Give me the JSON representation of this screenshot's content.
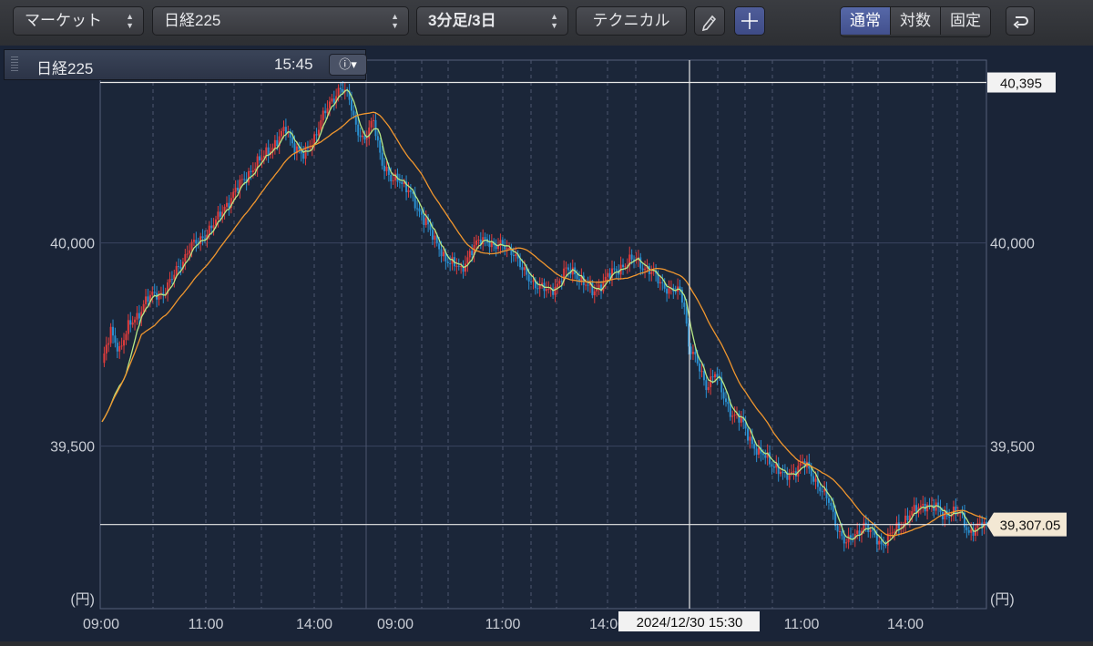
{
  "toolbar": {
    "market": "マーケット",
    "symbol": "日経225",
    "period": "3分足/3日",
    "technical": "テクニカル",
    "modes": [
      "通常",
      "対数",
      "固定"
    ]
  },
  "infobar": {
    "symbol": "日経225",
    "time": "15:45"
  },
  "icons": {
    "select_arrows": "up-down-chevron-icon",
    "pencil": "pencil-icon",
    "crosshair": "crosshair-icon",
    "undo": "undo-icon",
    "info": "info-icon"
  },
  "colors": {
    "background": "#1a2437",
    "up_candle": "#e03c3c",
    "down_candle": "#2a8fd0",
    "ma_short": "#b8e986",
    "ma_long": "#f0962e"
  },
  "chart_data": {
    "type": "line",
    "x_tick_labels": [
      "09:00",
      "11:00",
      "14:00",
      "09:00",
      "11:00",
      "14:00",
      "11:00",
      "14:00"
    ],
    "y_ticks": [
      40000,
      39500
    ],
    "y_tick_labels": [
      "40,000",
      "39,500"
    ],
    "y_unit": "(円)",
    "ylim": [
      39100,
      40450
    ],
    "high_label": "40,395",
    "high_value": 40395,
    "last_label": "39,307.05",
    "last_value": 39307.05,
    "cursor_label": "2024/12/30 15:30",
    "price_path": [
      [
        0,
        39700
      ],
      [
        4,
        39780
      ],
      [
        8,
        39740
      ],
      [
        12,
        39790
      ],
      [
        16,
        39820
      ],
      [
        20,
        39860
      ],
      [
        24,
        39870
      ],
      [
        28,
        39880
      ],
      [
        32,
        39910
      ],
      [
        36,
        39950
      ],
      [
        40,
        39990
      ],
      [
        44,
        40000
      ],
      [
        48,
        40030
      ],
      [
        52,
        40050
      ],
      [
        56,
        40090
      ],
      [
        60,
        40120
      ],
      [
        64,
        40150
      ],
      [
        68,
        40180
      ],
      [
        72,
        40200
      ],
      [
        76,
        40230
      ],
      [
        80,
        40250
      ],
      [
        84,
        40280
      ],
      [
        88,
        40240
      ],
      [
        92,
        40210
      ],
      [
        96,
        40250
      ],
      [
        100,
        40300
      ],
      [
        104,
        40340
      ],
      [
        108,
        40380
      ],
      [
        110,
        40380
      ],
      [
        113,
        40350
      ],
      [
        116,
        40290
      ],
      [
        120,
        40250
      ],
      [
        124,
        40300
      ],
      [
        128,
        40200
      ],
      [
        132,
        40150
      ],
      [
        136,
        40160
      ],
      [
        140,
        40130
      ],
      [
        144,
        40080
      ],
      [
        148,
        40060
      ],
      [
        152,
        40000
      ],
      [
        156,
        39970
      ],
      [
        160,
        39950
      ],
      [
        164,
        39930
      ],
      [
        168,
        39980
      ],
      [
        172,
        40000
      ],
      [
        176,
        40010
      ],
      [
        180,
        39990
      ],
      [
        184,
        39990
      ],
      [
        188,
        39980
      ],
      [
        192,
        39930
      ],
      [
        196,
        39910
      ],
      [
        200,
        39890
      ],
      [
        204,
        39880
      ],
      [
        208,
        39900
      ],
      [
        212,
        39930
      ],
      [
        216,
        39930
      ],
      [
        220,
        39900
      ],
      [
        224,
        39880
      ],
      [
        228,
        39900
      ],
      [
        232,
        39920
      ],
      [
        236,
        39940
      ],
      [
        240,
        39950
      ],
      [
        244,
        39960
      ],
      [
        248,
        39940
      ],
      [
        252,
        39920
      ],
      [
        256,
        39900
      ],
      [
        260,
        39880
      ],
      [
        264,
        39880
      ],
      [
        266,
        39850
      ],
      [
        268,
        39750
      ],
      [
        272,
        39700
      ],
      [
        276,
        39650
      ],
      [
        280,
        39680
      ],
      [
        284,
        39620
      ],
      [
        288,
        39580
      ],
      [
        292,
        39560
      ],
      [
        296,
        39520
      ],
      [
        300,
        39480
      ],
      [
        304,
        39470
      ],
      [
        308,
        39450
      ],
      [
        312,
        39420
      ],
      [
        316,
        39440
      ],
      [
        320,
        39460
      ],
      [
        324,
        39430
      ],
      [
        328,
        39400
      ],
      [
        332,
        39360
      ],
      [
        336,
        39300
      ],
      [
        340,
        39260
      ],
      [
        344,
        39280
      ],
      [
        348,
        39310
      ],
      [
        352,
        39280
      ],
      [
        356,
        39260
      ],
      [
        360,
        39280
      ],
      [
        364,
        39300
      ],
      [
        368,
        39330
      ],
      [
        372,
        39340
      ],
      [
        376,
        39360
      ],
      [
        380,
        39350
      ],
      [
        384,
        39330
      ],
      [
        388,
        39340
      ],
      [
        392,
        39330
      ],
      [
        396,
        39290
      ],
      [
        400,
        39300
      ],
      [
        404,
        39307.05
      ]
    ],
    "series": [
      {
        "name": "",
        "type": "candlestick"
      },
      {
        "name": "",
        "type": "ma",
        "period": 5
      },
      {
        "name": "",
        "type": "ma",
        "period": 25
      }
    ]
  }
}
